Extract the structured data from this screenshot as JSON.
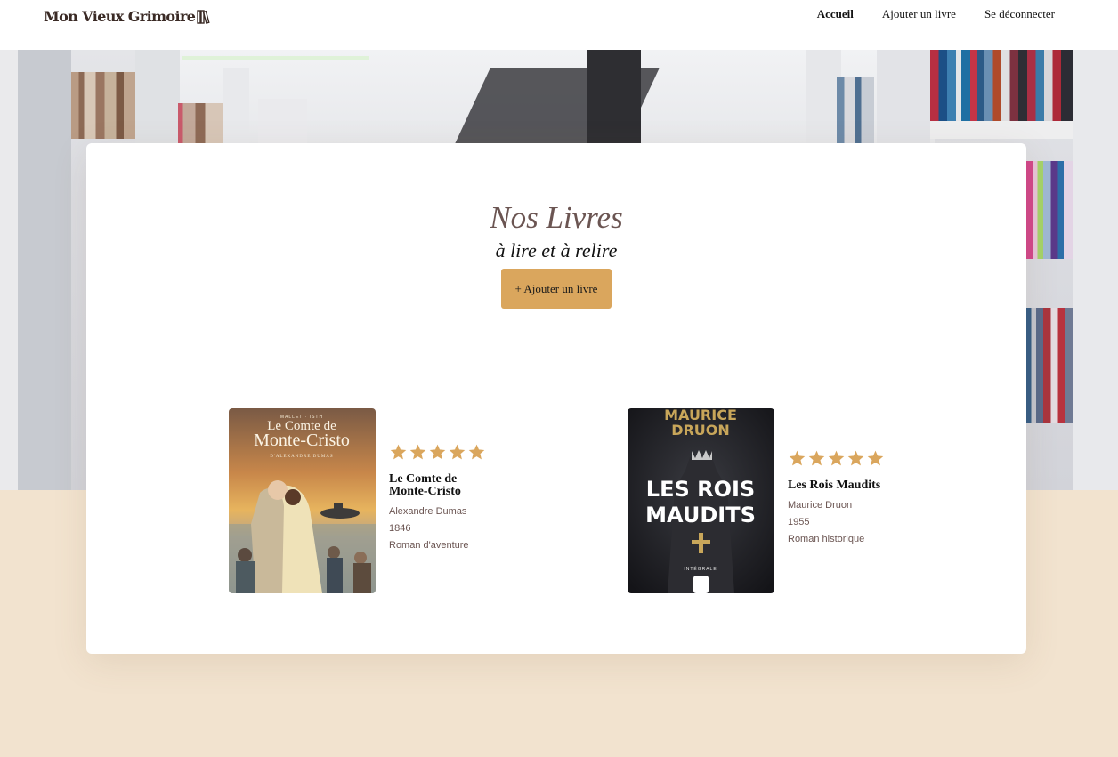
{
  "header": {
    "logo_text": "Mon Vieux Grimoire",
    "nav": [
      {
        "label": "Accueil",
        "active": true
      },
      {
        "label": "Ajouter un livre",
        "active": false
      },
      {
        "label": "Se déconnecter",
        "active": false
      }
    ]
  },
  "main": {
    "title": "Nos Livres",
    "subtitle": "à lire et à relire",
    "add_button": "+ Ajouter un livre"
  },
  "books": [
    {
      "cover_top": "MALLET · ISTH",
      "cover_title_1": "Le Comte de",
      "cover_title_2": "Monte-Cristo",
      "cover_sub": "D'ALEXANDRE DUMAS",
      "rating": 5,
      "title": "Le Comte de Monte-Cristo",
      "author": "Alexandre Dumas",
      "year": "1846",
      "genre": "Roman d'aventure"
    },
    {
      "cover_author_1": "MAURICE",
      "cover_author_2": "DRUON",
      "cover_title_1": "LES ROIS",
      "cover_title_2": "MAUDITS",
      "cover_edition": "INTÉGRALE",
      "rating": 5,
      "title": "Les Rois Maudits",
      "author": "Maurice Druon",
      "year": "1955",
      "genre": "Roman historique"
    }
  ],
  "colors": {
    "accent": "#daa65d",
    "star": "#daa65d",
    "muted_text": "#6b5552",
    "page_bg": "#f2e3cf"
  }
}
